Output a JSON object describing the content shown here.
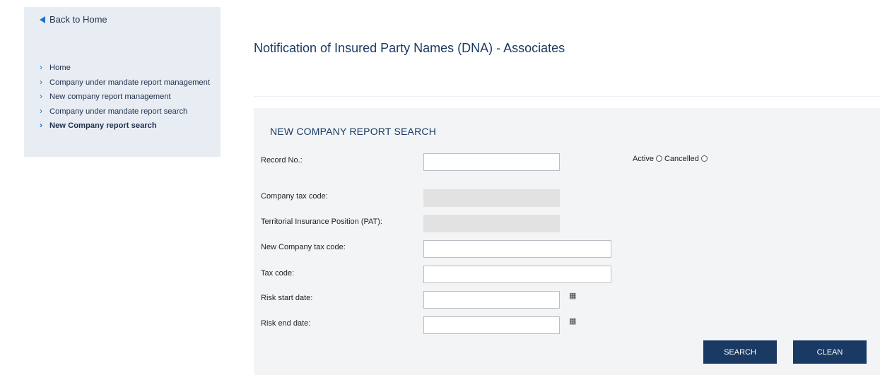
{
  "sidebar": {
    "back_label": "Back to Home",
    "items": [
      {
        "label": "Home"
      },
      {
        "label": "Company under mandate report management"
      },
      {
        "label": "New company report management"
      },
      {
        "label": "Company under mandate report search"
      },
      {
        "label": "New Company report search",
        "active": true
      }
    ]
  },
  "page": {
    "title": "Notification of Insured Party Names (DNA) - Associates"
  },
  "form": {
    "section_title": "NEW COMPANY REPORT SEARCH",
    "record_no_label": "Record No.:",
    "record_no_value": "",
    "status_active_label": "Active",
    "status_cancelled_label": "Cancelled",
    "company_tax_code_label": "Company tax code:",
    "company_tax_code_value": "",
    "pat_label": "Territorial Insurance Position (PAT):",
    "pat_value": "",
    "new_company_tax_code_label": "New Company tax code:",
    "new_company_tax_code_value": "",
    "tax_code_label": "Tax code:",
    "tax_code_value": "",
    "risk_start_label": "Risk start date:",
    "risk_start_value": "",
    "risk_end_label": "Risk end date:",
    "risk_end_value": "",
    "calendar_icon_glyph": "▦",
    "search_label": "SEARCH",
    "clean_label": "CLEAN"
  },
  "colors": {
    "accent": "#1b3a63",
    "link_arrow": "#1a73c8",
    "sidebar_bg": "#e8edf3",
    "panel_bg": "#f2f4f6"
  }
}
